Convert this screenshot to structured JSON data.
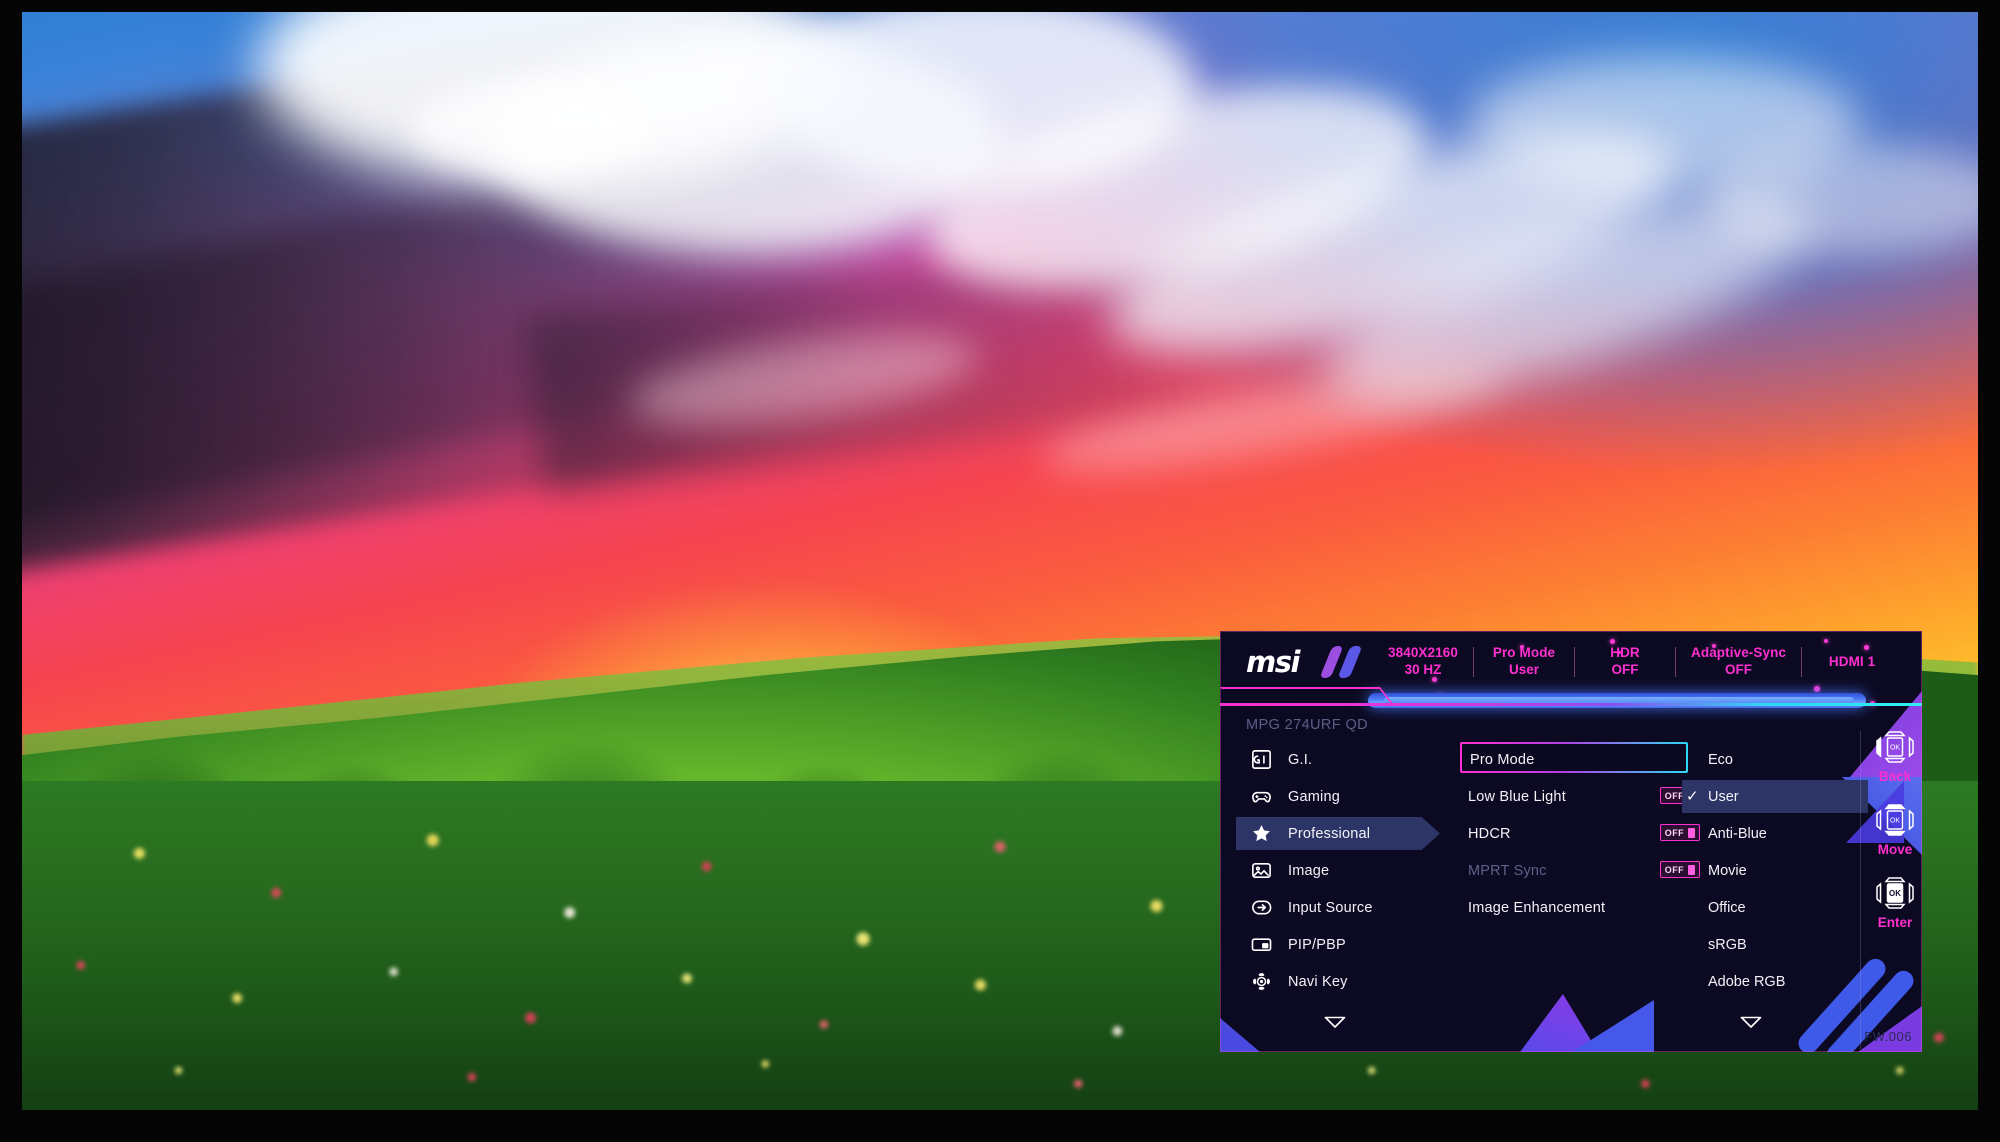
{
  "monitor": {
    "model_label": "MPG 274URF QD",
    "brand": "msi",
    "firmware": "FW.006"
  },
  "osd": {
    "status_bar": [
      {
        "name": "resolution",
        "top": "3840X2160",
        "bottom": "30 HZ"
      },
      {
        "name": "pro-mode",
        "top": "Pro Mode",
        "bottom": "User"
      },
      {
        "name": "hdr",
        "top": "HDR",
        "bottom": "OFF"
      },
      {
        "name": "adaptive-sync",
        "top": "Adaptive-Sync",
        "bottom": "OFF"
      },
      {
        "name": "input",
        "top": "HDMI 1",
        "bottom": ""
      }
    ],
    "sidebar": {
      "items": [
        {
          "label": "G.I.",
          "icon": "gaming-intelligence-icon",
          "active": false
        },
        {
          "label": "Gaming",
          "icon": "gamepad-icon",
          "active": false
        },
        {
          "label": "Professional",
          "icon": "star-icon",
          "active": true
        },
        {
          "label": "Image",
          "icon": "picture-icon",
          "active": false
        },
        {
          "label": "Input Source",
          "icon": "input-arrow-icon",
          "active": false
        },
        {
          "label": "PIP/PBP",
          "icon": "pip-pbp-icon",
          "active": false
        },
        {
          "label": "Navi Key",
          "icon": "navi-key-icon",
          "active": false
        }
      ],
      "scroll_hint": "scroll-down-chevron"
    },
    "settings": {
      "items": [
        {
          "label": "Pro Mode",
          "selected": true,
          "dimmed": false,
          "toggle": null
        },
        {
          "label": "Low Blue Light",
          "selected": false,
          "dimmed": false,
          "toggle": "OFF"
        },
        {
          "label": "HDCR",
          "selected": false,
          "dimmed": false,
          "toggle": "OFF"
        },
        {
          "label": "MPRT Sync",
          "selected": false,
          "dimmed": true,
          "toggle": "OFF"
        },
        {
          "label": "Image Enhancement",
          "selected": false,
          "dimmed": false,
          "toggle": null
        }
      ]
    },
    "options": {
      "items": [
        {
          "label": "Eco",
          "checked": false
        },
        {
          "label": "User",
          "checked": true
        },
        {
          "label": "Anti-Blue",
          "checked": false
        },
        {
          "label": "Movie",
          "checked": false
        },
        {
          "label": "Office",
          "checked": false
        },
        {
          "label": "sRGB",
          "checked": false
        },
        {
          "label": "Adobe RGB",
          "checked": false
        }
      ],
      "scroll_hint": "scroll-down-chevron"
    },
    "nav_hints": [
      {
        "label": "Back",
        "icon": "joystick-left-icon"
      },
      {
        "label": "Move",
        "icon": "joystick-updown-icon"
      },
      {
        "label": "Enter",
        "icon": "joystick-ok-icon"
      }
    ]
  },
  "colors": {
    "accent_magenta": "#ff2fd0",
    "accent_cyan": "#2fd8f5",
    "panel_bg": "#0c0a22",
    "highlight_row": "#2c3566",
    "text_primary": "#f2f2f8",
    "text_dim": "#5d6088"
  }
}
